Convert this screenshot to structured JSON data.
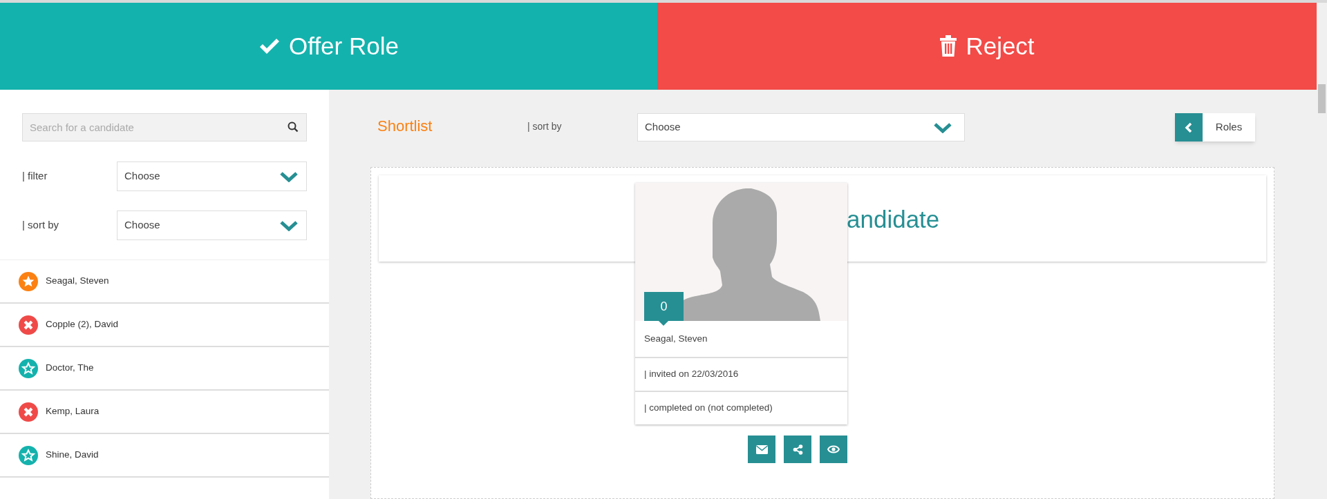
{
  "actions": [
    {
      "kind": "offer",
      "label": "Offer Role"
    },
    {
      "kind": "reject",
      "label": "Reject"
    }
  ],
  "sidebar": {
    "search": {
      "placeholder": "Search for a candidate"
    },
    "filter": {
      "label": "| filter",
      "value": "Choose"
    },
    "sort": {
      "label": "| sort by",
      "value": "Choose"
    },
    "candidates": [
      {
        "kind": "starred",
        "color": "#fb8113",
        "name": "Seagal, Steven"
      },
      {
        "kind": "rejected",
        "color": "#ef4a48",
        "name": "Copple (2), David"
      },
      {
        "kind": "candidate",
        "color": "#14b2ad",
        "name": "Doctor, The"
      },
      {
        "kind": "rejected",
        "color": "#ef4a48",
        "name": "Kemp, Laura"
      },
      {
        "kind": "candidate",
        "color": "#14b2ad",
        "name": "Shine, David"
      }
    ]
  },
  "main": {
    "title": "Shortlist",
    "sort": {
      "label": "| sort by",
      "value": "Choose"
    },
    "back_button": "Roles",
    "panel_heading": "andidate",
    "card": {
      "score": "0",
      "name": "Seagal, Steven",
      "invited": "| invited on 22/03/2016",
      "completed": "| completed on (not completed)"
    }
  }
}
